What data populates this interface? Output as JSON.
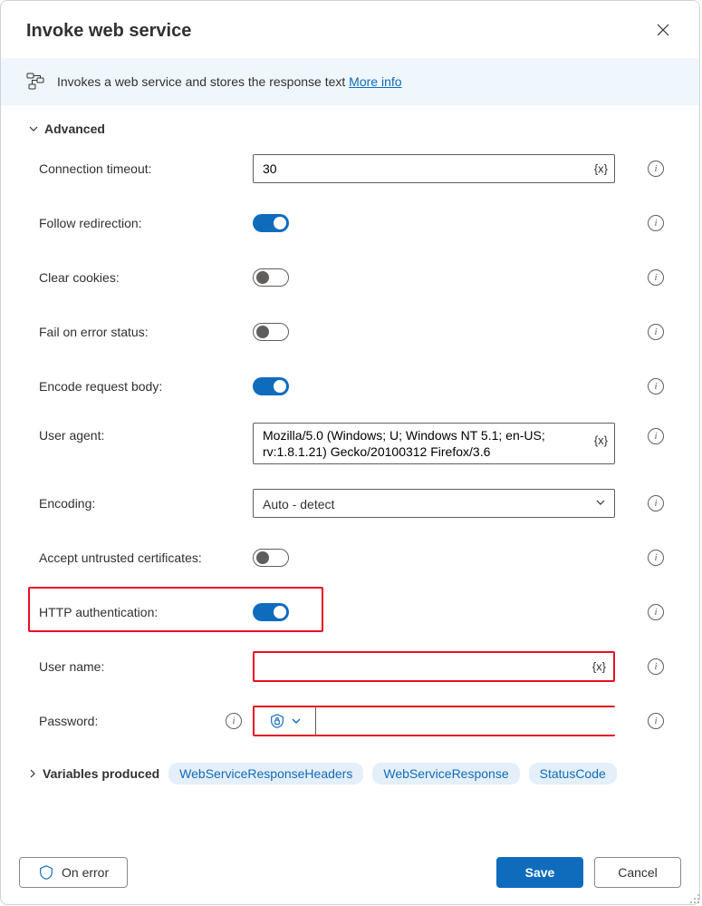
{
  "header": {
    "title": "Invoke web service"
  },
  "description": {
    "text": "Invokes a web service and stores the response text ",
    "link_label": "More info"
  },
  "section_advanced": "Advanced",
  "fields": {
    "connection_timeout": {
      "label": "Connection timeout:",
      "value": "30"
    },
    "follow_redirection": {
      "label": "Follow redirection:",
      "on": true
    },
    "clear_cookies": {
      "label": "Clear cookies:",
      "on": false
    },
    "fail_on_error": {
      "label": "Fail on error status:",
      "on": false
    },
    "encode_body": {
      "label": "Encode request body:",
      "on": true
    },
    "user_agent": {
      "label": "User agent:",
      "value": "Mozilla/5.0 (Windows; U; Windows NT 5.1; en-US; rv:1.8.1.21) Gecko/20100312 Firefox/3.6"
    },
    "encoding": {
      "label": "Encoding:",
      "value": "Auto - detect"
    },
    "accept_untrusted": {
      "label": "Accept untrusted certificates:",
      "on": false
    },
    "http_auth": {
      "label": "HTTP authentication:",
      "on": true
    },
    "username": {
      "label": "User name:",
      "value": ""
    },
    "password": {
      "label": "Password:",
      "value": ""
    }
  },
  "variables_produced": {
    "header": "Variables produced",
    "items": [
      "WebServiceResponseHeaders",
      "WebServiceResponse",
      "StatusCode"
    ]
  },
  "footer": {
    "on_error": "On error",
    "save": "Save",
    "cancel": "Cancel"
  },
  "icons": {
    "var_token": "{x}"
  }
}
